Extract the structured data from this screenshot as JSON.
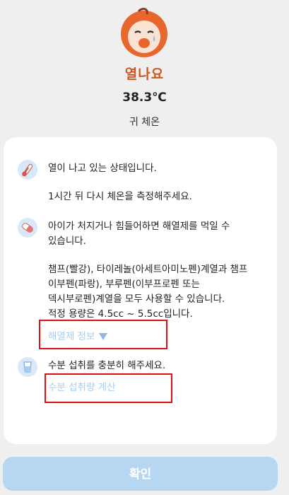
{
  "header": {
    "status_title": "열나요",
    "temperature": "38.3℃",
    "method": "귀 체온"
  },
  "card": {
    "thermometer_icon": "thermometer-icon",
    "fever_message": "열이 나고 있는 상태입니다.",
    "remeasure_message": "1시간 뒤 다시 체온을 측정해주세요.",
    "medicine_icon": "pill-capsule-icon",
    "medicine_message": "아이가 처지거나 힘들어하면 해열제를 먹일 수\n있습니다.",
    "medicine_detail": "챔프(빨강), 타이레놀(아세트아미노펜)계열과 챔프\n이부펜(파랑), 부루펜(이부프로펜 또는\n덱시부로펜)계열을 모두 사용할 수 있습니다.\n적정 용량은 4.5cc ~ 5.5cc입니다.",
    "fever_reducer_info_link": "해열제 정보",
    "water_icon": "water-glass-icon",
    "water_message": "수분 섭취를 충분히 해주세요.",
    "water_calc_link": "수분 섭취량 계산"
  },
  "confirm_button": "확인",
  "colors": {
    "status_accent": "#c9571f",
    "link": "#a9cdee",
    "button_bg": "#b7d6f1",
    "highlight_box": "#e01010"
  }
}
